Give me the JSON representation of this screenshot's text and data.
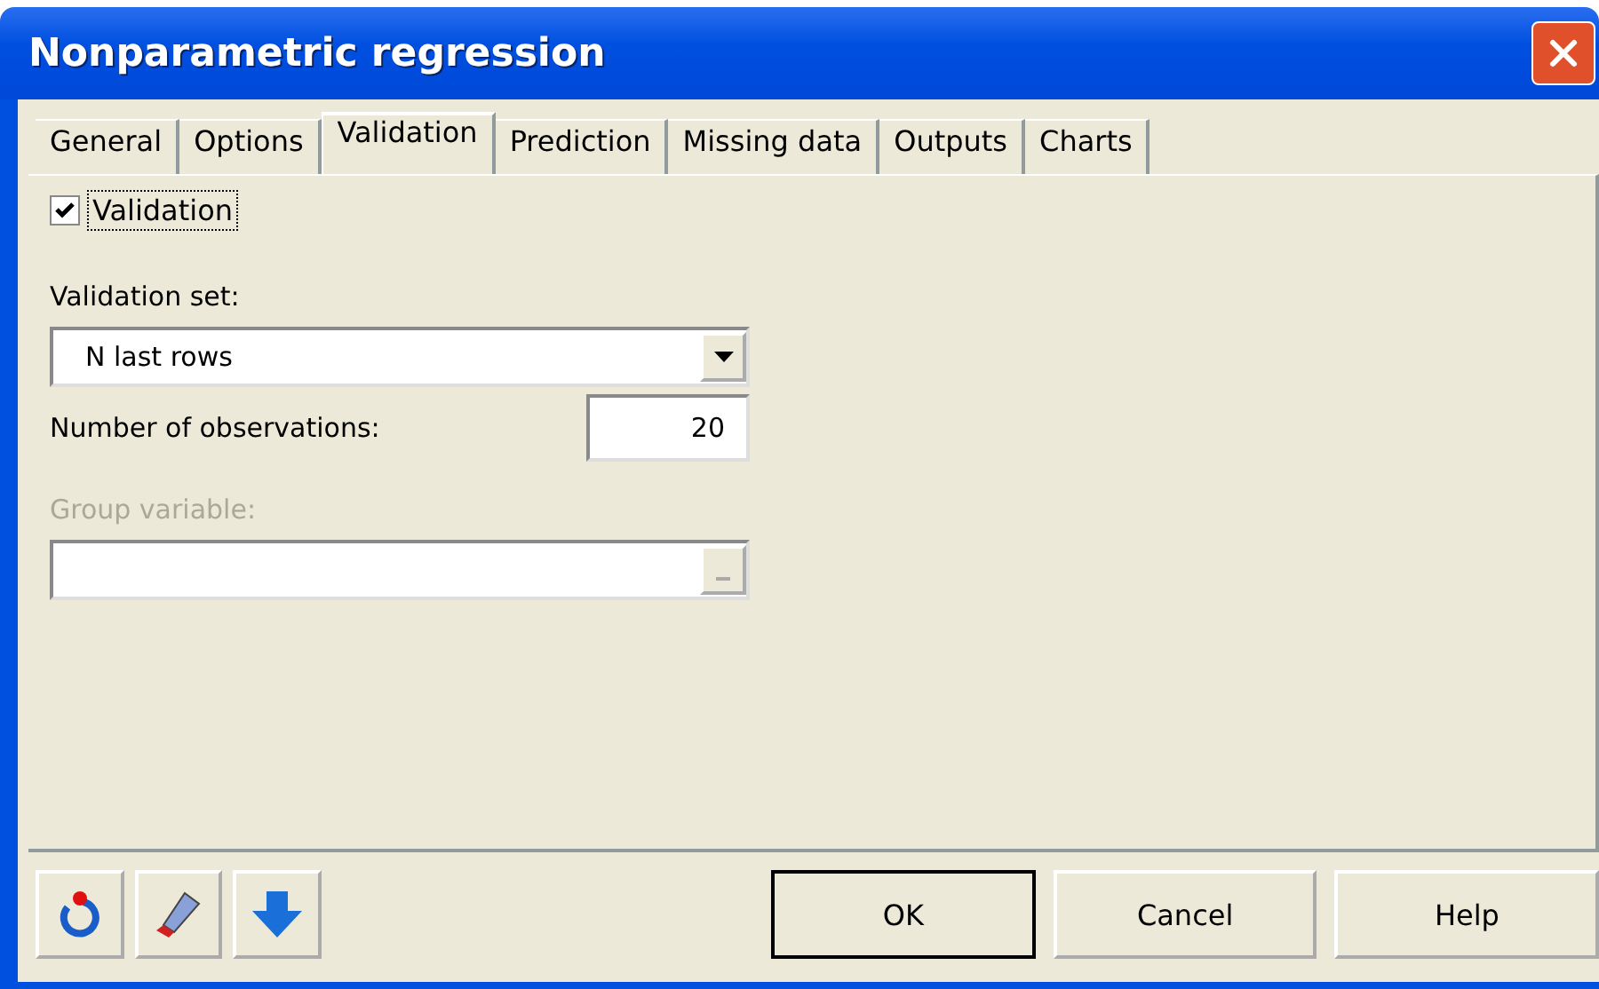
{
  "window": {
    "title": "Nonparametric regression"
  },
  "tabs": [
    {
      "label": "General",
      "selected": false
    },
    {
      "label": "Options",
      "selected": false
    },
    {
      "label": "Validation",
      "selected": true
    },
    {
      "label": "Prediction",
      "selected": false
    },
    {
      "label": "Missing data",
      "selected": false
    },
    {
      "label": "Outputs",
      "selected": false
    },
    {
      "label": "Charts",
      "selected": false
    }
  ],
  "validation_checkbox": {
    "label": "Validation",
    "checked": true,
    "focused": true
  },
  "validation_set": {
    "label": "Validation set:",
    "value": "N last rows"
  },
  "observations": {
    "label": "Number of observations:",
    "value": "20"
  },
  "group_variable": {
    "label": "Group variable:",
    "disabled": true
  },
  "buttons": [
    {
      "label": "OK",
      "default": true
    },
    {
      "label": "Cancel",
      "default": false
    },
    {
      "label": "Help",
      "default": false
    }
  ]
}
